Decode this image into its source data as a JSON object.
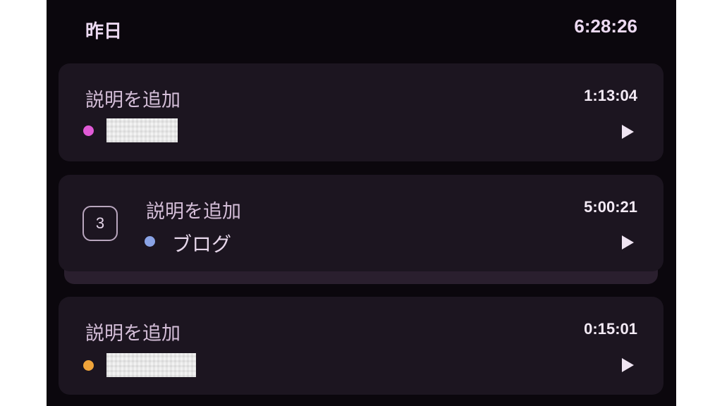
{
  "section": {
    "title": "昨日",
    "total": "6:28:26"
  },
  "entries": [
    {
      "description": "説明を追加",
      "duration": "1:13:04",
      "project": {
        "color": "#e05ad6",
        "label_redacted": true
      },
      "play_icon": "play-icon"
    },
    {
      "group_count": "3",
      "description": "説明を追加",
      "duration": "5:00:21",
      "project": {
        "color": "#8aa3e6",
        "label": "ブログ"
      },
      "play_icon": "play-icon"
    },
    {
      "description": "説明を追加",
      "duration": "0:15:01",
      "project": {
        "color": "#f0a43a",
        "label_redacted": true
      },
      "play_icon": "play-icon"
    }
  ],
  "colors": {
    "background": "#0b070d",
    "card": "#1c1520",
    "text_primary": "#f3eaf5",
    "text_secondary": "#d4bed8"
  }
}
